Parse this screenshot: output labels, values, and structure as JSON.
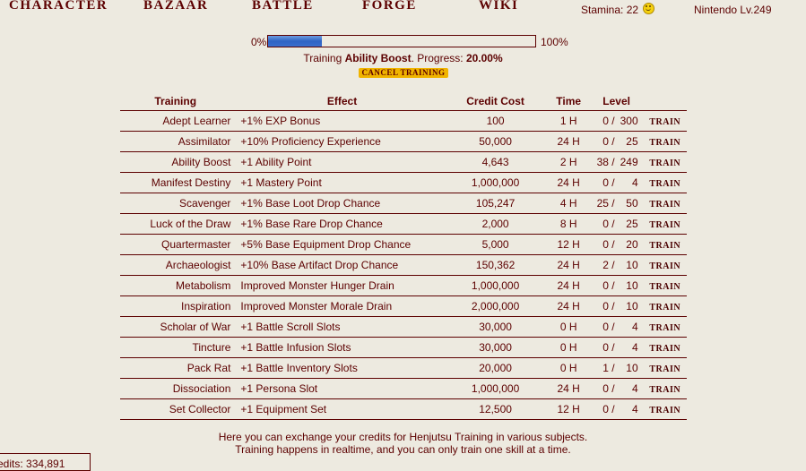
{
  "nav": {
    "character": "CHARACTER",
    "bazaar": "BAZAAR",
    "battle": "BATTLE",
    "forge": "FORGE",
    "wiki": "WIKI"
  },
  "status": {
    "stamina_label": "Stamina: 22",
    "player": "Nintendo Lv.249"
  },
  "progress": {
    "left": "0%",
    "right": "100%",
    "fraction": 0.2,
    "prefix": "Training ",
    "skill": "Ability Boost",
    "middle": ". Progress: ",
    "percent": "20.00%",
    "cancel_label": "CANCEL TRAINING"
  },
  "table": {
    "headers": [
      "Training",
      "Effect",
      "Credit Cost",
      "Time",
      "Level"
    ],
    "train_label": "TRAIN",
    "rows": [
      {
        "name": "Adept Learner",
        "effect": "+1% EXP Bonus",
        "cost": "100",
        "time": "1 H",
        "level": "0 /",
        "max": "300"
      },
      {
        "name": "Assimilator",
        "effect": "+10% Proficiency Experience",
        "cost": "50,000",
        "time": "24 H",
        "level": "0 /",
        "max": "25"
      },
      {
        "name": "Ability Boost",
        "effect": "+1 Ability Point",
        "cost": "4,643",
        "time": "2 H",
        "level": "38 /",
        "max": "249"
      },
      {
        "name": "Manifest Destiny",
        "effect": "+1 Mastery Point",
        "cost": "1,000,000",
        "time": "24 H",
        "level": "0 /",
        "max": "4"
      },
      {
        "name": "Scavenger",
        "effect": "+1% Base Loot Drop Chance",
        "cost": "105,247",
        "time": "4 H",
        "level": "25 /",
        "max": "50"
      },
      {
        "name": "Luck of the Draw",
        "effect": "+1% Base Rare Drop Chance",
        "cost": "2,000",
        "time": "8 H",
        "level": "0 /",
        "max": "25"
      },
      {
        "name": "Quartermaster",
        "effect": "+5% Base Equipment Drop Chance",
        "cost": "5,000",
        "time": "12 H",
        "level": "0 /",
        "max": "20"
      },
      {
        "name": "Archaeologist",
        "effect": "+10% Base Artifact Drop Chance",
        "cost": "150,362",
        "time": "24 H",
        "level": "2 /",
        "max": "10"
      },
      {
        "name": "Metabolism",
        "effect": "Improved Monster Hunger Drain",
        "cost": "1,000,000",
        "time": "24 H",
        "level": "0 /",
        "max": "10"
      },
      {
        "name": "Inspiration",
        "effect": "Improved Monster Morale Drain",
        "cost": "2,000,000",
        "time": "24 H",
        "level": "0 /",
        "max": "10"
      },
      {
        "name": "Scholar of War",
        "effect": "+1 Battle Scroll Slots",
        "cost": "30,000",
        "time": "0 H",
        "level": "0 /",
        "max": "4"
      },
      {
        "name": "Tincture",
        "effect": "+1 Battle Infusion Slots",
        "cost": "30,000",
        "time": "0 H",
        "level": "0 /",
        "max": "4"
      },
      {
        "name": "Pack Rat",
        "effect": "+1 Battle Inventory Slots",
        "cost": "20,000",
        "time": "0 H",
        "level": "1 /",
        "max": "10"
      },
      {
        "name": "Dissociation",
        "effect": "+1 Persona Slot",
        "cost": "1,000,000",
        "time": "24 H",
        "level": "0 /",
        "max": "4"
      },
      {
        "name": "Set Collector",
        "effect": "+1 Equipment Set",
        "cost": "12,500",
        "time": "12 H",
        "level": "0 /",
        "max": "4"
      }
    ]
  },
  "footer": {
    "line1": "Here you can exchange your credits for Henjutsu Training in various subjects.",
    "line2": "Training happens in realtime, and you can only train one skill at a time."
  },
  "credits": "edits: 334,891"
}
